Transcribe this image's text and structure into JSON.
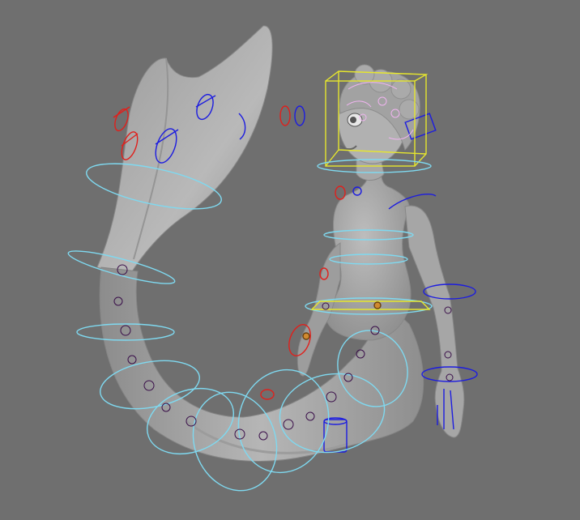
{
  "viewport": {
    "background": "#6f6f6f",
    "mesh_color": "#a9a9a9",
    "colors": {
      "fk_left": "#e0201c",
      "fk_right": "#1c1ce0",
      "fk_center": "#e6e62e",
      "ik_ring": "#7fd9f0",
      "joint": "#3a0f4a",
      "face": "#f0b4f0",
      "pivot": "#d08a30"
    },
    "model": "mermaid-character-rig",
    "icons": [
      "fk-circle-control",
      "ik-ring-control",
      "joint-marker",
      "head-box-control"
    ]
  }
}
